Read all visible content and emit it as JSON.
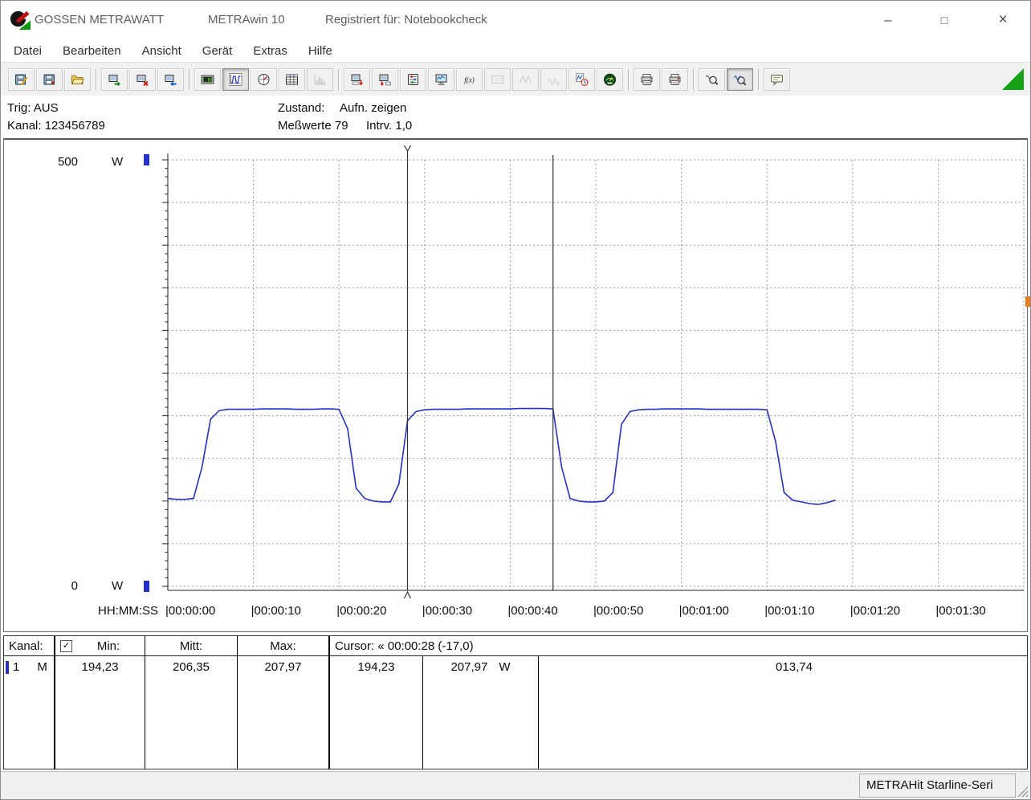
{
  "window": {
    "brand": "GOSSEN METRAWATT",
    "app": "METRAwin 10",
    "registration": "Registriert für: Notebookcheck",
    "minimize": "–",
    "maximize": "□",
    "close": "×"
  },
  "menu": {
    "items": [
      "Datei",
      "Bearbeiten",
      "Ansicht",
      "Gerät",
      "Extras",
      "Hilfe"
    ]
  },
  "toolbar": {
    "items": [
      {
        "icon": "disk-pencil",
        "name": "file-save-as"
      },
      {
        "icon": "disk",
        "name": "file-save"
      },
      {
        "icon": "folder-open",
        "name": "file-open"
      },
      {
        "sep": true
      },
      {
        "icon": "device-in",
        "name": "device-read"
      },
      {
        "icon": "device-x",
        "name": "device-clear"
      },
      {
        "icon": "device-out",
        "name": "device-write"
      },
      {
        "sep": true
      },
      {
        "icon": "numeric-display",
        "name": "view-numeric"
      },
      {
        "icon": "line-chart",
        "name": "view-chart",
        "state": "pressed"
      },
      {
        "icon": "analog-meter",
        "name": "view-analog"
      },
      {
        "icon": "table",
        "name": "view-table"
      },
      {
        "icon": "histogram",
        "name": "view-histogram",
        "state": "disabled"
      },
      {
        "sep": true
      },
      {
        "icon": "device-config",
        "name": "device-config"
      },
      {
        "icon": "device-download",
        "name": "device-download"
      },
      {
        "icon": "meter-config",
        "name": "meter-config"
      },
      {
        "icon": "monitor",
        "name": "online-monitor"
      },
      {
        "icon": "fx",
        "name": "function"
      },
      {
        "icon": "display2",
        "name": "display",
        "state": "disabled"
      },
      {
        "icon": "wave-x",
        "name": "signal-a",
        "state": "disabled"
      },
      {
        "icon": "wave-m",
        "name": "signal-b",
        "state": "disabled"
      },
      {
        "icon": "chart-clock",
        "name": "time-chart"
      },
      {
        "icon": "live-meter",
        "name": "live-meter"
      },
      {
        "sep": true
      },
      {
        "icon": "printer",
        "name": "print"
      },
      {
        "icon": "printer2",
        "name": "print-setup"
      },
      {
        "sep": true
      },
      {
        "icon": "zoom-m",
        "name": "zoom-horizontal"
      },
      {
        "icon": "zoom-wave",
        "name": "zoom-curve",
        "state": "pressed"
      },
      {
        "sep": true
      },
      {
        "icon": "comment",
        "name": "comment"
      }
    ]
  },
  "status_panel": {
    "trig": "Trig: AUS",
    "kanal": "Kanal: 123456789",
    "zustand_label": "Zustand:",
    "zustand_value": "Aufn. zeigen",
    "messwerte": "Meßwerte 79",
    "intervall": "Intrv. 1,0"
  },
  "chart_data": {
    "type": "line",
    "x_axis_title": "HH:MM:SS",
    "y_unit": "W",
    "y_tick_top": "500",
    "y_tick_bottom": "0",
    "ylim": [
      0,
      500
    ],
    "xlim_seconds": [
      0,
      100
    ],
    "grid": true,
    "sample_interval_s": 1.0,
    "x_tick_labels": [
      "00:00:00",
      "00:00:10",
      "00:00:20",
      "00:00:30",
      "00:00:40",
      "00:00:50",
      "00:01:00",
      "00:01:10",
      "00:01:20",
      "00:01:30"
    ],
    "series": [
      {
        "name": "Kanal 1",
        "unit": "W",
        "color": "#2330cc",
        "values": [
          103,
          102,
          102,
          103,
          140,
          196,
          206,
          207.5,
          207.5,
          207.5,
          207.5,
          208,
          208,
          208,
          208,
          207.5,
          207.5,
          207.5,
          208,
          208,
          207.5,
          185,
          115,
          103,
          100,
          99,
          99,
          120,
          194.2,
          205,
          207,
          207.5,
          207.5,
          207.5,
          207.5,
          208,
          208,
          208,
          208,
          208,
          208,
          208.5,
          208.5,
          208.5,
          208.5,
          208,
          140,
          103,
          100,
          99,
          99,
          100,
          110,
          190,
          205,
          207,
          207.5,
          207.5,
          208,
          208,
          208,
          208,
          208,
          207.5,
          207.5,
          207.5,
          207.5,
          207.5,
          207.5,
          207.5,
          207,
          170,
          110,
          101,
          99,
          97,
          96,
          98,
          101
        ]
      }
    ],
    "cursors": [
      {
        "t_seconds": 28,
        "time": "00:00:28",
        "value": "194,23"
      },
      {
        "t_seconds": 45,
        "time": "00:00:45",
        "value": "207,97"
      }
    ]
  },
  "channel_table": {
    "header": {
      "kanal": "Kanal:",
      "check": "✓",
      "min": "Min:",
      "mitt": "Mitt:",
      "max": "Max:",
      "cursor": "Cursor: « 00:00:28 (-17,0)"
    },
    "row": {
      "channel": "1",
      "flag": "M",
      "min": "194,23",
      "mitt": "206,35",
      "max": "207,97",
      "cursor1": "194,23",
      "cursor2": "207,97",
      "unit": "W",
      "delta": "013,74"
    }
  },
  "statusbar": {
    "device": "METRAHit Starline-Seri"
  },
  "colors": {
    "series": "#2330cc",
    "grid": "#9c9c9c",
    "cursor": "#333333",
    "channel_marker": "#2330cc",
    "indicator_green": "#17a317",
    "edge_orange": "#e8801e"
  }
}
